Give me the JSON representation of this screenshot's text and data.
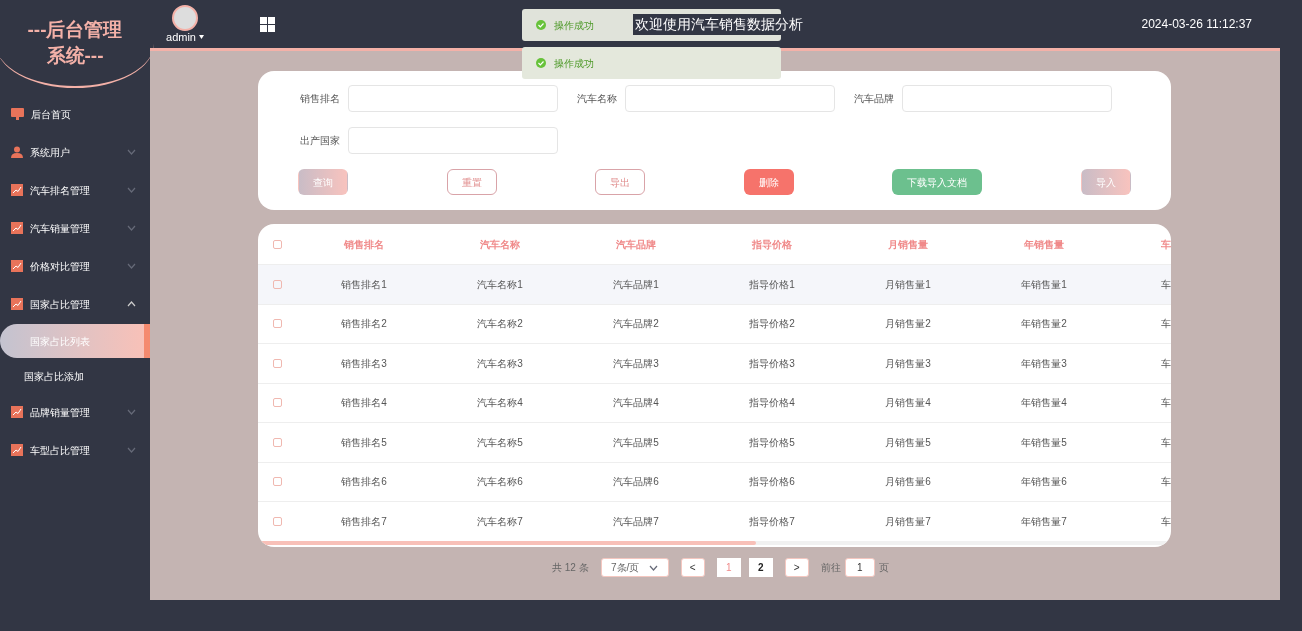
{
  "sidebar": {
    "title_line1": "---后台管理",
    "title_line2": "系统---",
    "items": [
      {
        "label": "后台首页"
      },
      {
        "label": "系统用户",
        "expanded": false
      },
      {
        "label": "汽车排名管理",
        "expanded": false
      },
      {
        "label": "汽车销量管理",
        "expanded": false
      },
      {
        "label": "价格对比管理",
        "expanded": false
      },
      {
        "label": "国家占比管理",
        "expanded": true,
        "children": [
          {
            "label": "国家占比列表",
            "selected": true
          },
          {
            "label": "国家占比添加",
            "selected": false
          }
        ]
      },
      {
        "label": "品牌销量管理",
        "expanded": false
      },
      {
        "label": "车型占比管理",
        "expanded": false
      }
    ]
  },
  "header": {
    "user": "admin",
    "title": "欢迎使用汽车销售数据分析",
    "datetime": "2024-03-26 11:12:37"
  },
  "toasts": [
    "操作成功",
    "操作成功"
  ],
  "search": {
    "fields": [
      {
        "label": "销售排名"
      },
      {
        "label": "汽车名称"
      },
      {
        "label": "汽车品牌"
      },
      {
        "label": "出产国家"
      }
    ],
    "buttons": [
      {
        "label": "查询",
        "kind": "gradient"
      },
      {
        "label": "重置",
        "kind": "outline"
      },
      {
        "label": "导出",
        "kind": "outline"
      },
      {
        "label": "删除",
        "kind": "danger"
      },
      {
        "label": "下载导入文档",
        "kind": "success"
      },
      {
        "label": "导入",
        "kind": "gradient"
      }
    ]
  },
  "table": {
    "all_checked": false,
    "columns": [
      "销售排名",
      "汽车名称",
      "汽车品牌",
      "指导价格",
      "月销售量",
      "年销售量",
      "车"
    ],
    "rows": [
      {
        "checked": false,
        "cells": [
          "销售排名1",
          "汽车名称1",
          "汽车品牌1",
          "指导价格1",
          "月销售量1",
          "年销售量1",
          "车"
        ]
      },
      {
        "checked": false,
        "cells": [
          "销售排名2",
          "汽车名称2",
          "汽车品牌2",
          "指导价格2",
          "月销售量2",
          "年销售量2",
          "车"
        ]
      },
      {
        "checked": false,
        "cells": [
          "销售排名3",
          "汽车名称3",
          "汽车品牌3",
          "指导价格3",
          "月销售量3",
          "年销售量3",
          "车"
        ]
      },
      {
        "checked": false,
        "cells": [
          "销售排名4",
          "汽车名称4",
          "汽车品牌4",
          "指导价格4",
          "月销售量4",
          "年销售量4",
          "车"
        ]
      },
      {
        "checked": false,
        "cells": [
          "销售排名5",
          "汽车名称5",
          "汽车品牌5",
          "指导价格5",
          "月销售量5",
          "年销售量5",
          "车"
        ]
      },
      {
        "checked": false,
        "cells": [
          "销售排名6",
          "汽车名称6",
          "汽车品牌6",
          "指导价格6",
          "月销售量6",
          "年销售量6",
          "车"
        ]
      },
      {
        "checked": false,
        "cells": [
          "销售排名7",
          "汽车名称7",
          "汽车品牌7",
          "指导价格7",
          "月销售量7",
          "年销售量7",
          "车"
        ]
      }
    ]
  },
  "pagination": {
    "total": "共 12 条",
    "page_size": "7条/页",
    "prev": "<",
    "next": ">",
    "pages": [
      {
        "label": "1",
        "selected": true
      },
      {
        "label": "2",
        "selected": false
      }
    ],
    "goto_label": "前往",
    "goto_value": "1",
    "goto_suffix": "页"
  }
}
